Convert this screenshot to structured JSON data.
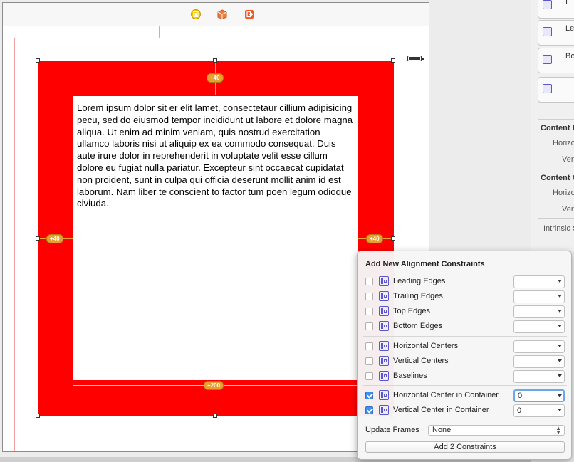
{
  "canvas": {
    "dock_icons": [
      "view-controller-icon",
      "first-responder-icon",
      "exit-icon"
    ],
    "colors": {
      "red_view": "#ff0000",
      "constraint": "#e8a030",
      "accent": "#3b8ff0"
    }
  },
  "text_view": {
    "text": "Lorem ipsum dolor sit er elit lamet, consectetaur cillium adipisicing pecu, sed do eiusmod tempor incididunt ut labore et dolore magna aliqua. Ut enim ad minim veniam, quis nostrud exercitation ullamco laboris nisi ut aliquip ex ea commodo consequat. Duis aute irure dolor in reprehenderit in voluptate velit esse cillum dolore eu fugiat nulla pariatur. Excepteur sint occaecat cupidatat non proident, sunt in culpa qui officia deserunt mollit anim id est laborum. Nam liber te conscient to factor tum poen legum odioque civiuda."
  },
  "constraint_badges": {
    "top": "+40",
    "left": "+40",
    "right": "+40",
    "bottom": "+200"
  },
  "inspector": {
    "library_items": [
      "I",
      "Lea",
      "Bo",
      ""
    ],
    "sections": [
      {
        "title": "Content H",
        "rows": [
          "Horizo",
          "Verti"
        ]
      },
      {
        "title": "Content C",
        "rows": [
          "Horizo",
          "Verti"
        ]
      }
    ],
    "intrinsic": "Intrinsic S"
  },
  "popover": {
    "title": "Add New Alignment Constraints",
    "rows": [
      {
        "label": "Leading Edges",
        "checked": false,
        "value": ""
      },
      {
        "label": "Trailing Edges",
        "checked": false,
        "value": ""
      },
      {
        "label": "Top Edges",
        "checked": false,
        "value": ""
      },
      {
        "label": "Bottom Edges",
        "checked": false,
        "value": ""
      },
      {
        "label": "Horizontal Centers",
        "checked": false,
        "value": ""
      },
      {
        "label": "Vertical Centers",
        "checked": false,
        "value": ""
      },
      {
        "label": "Baselines",
        "checked": false,
        "value": ""
      },
      {
        "label": "Horizontal Center in Container",
        "checked": true,
        "value": "0"
      },
      {
        "label": "Vertical Center in Container",
        "checked": true,
        "value": "0"
      }
    ],
    "update_frames_label": "Update Frames",
    "update_frames_value": "None",
    "add_button": "Add 2 Constraints"
  }
}
